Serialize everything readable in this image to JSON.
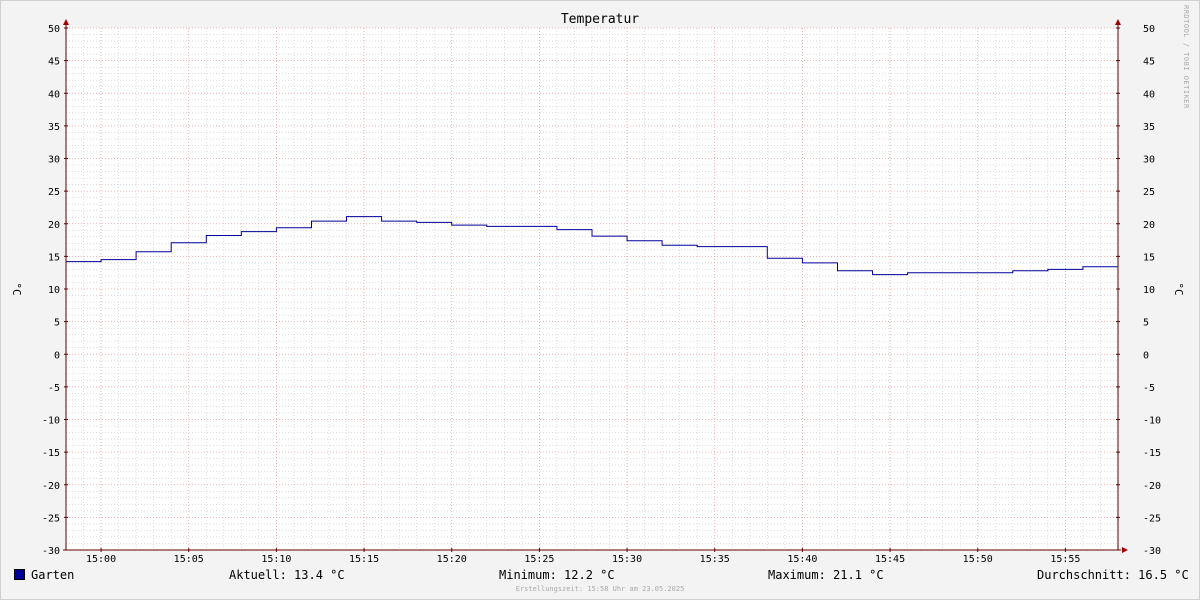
{
  "chart_data": {
    "type": "line",
    "title": "Temperatur",
    "ylabel": "°C",
    "ylabel_right": "°C",
    "ylim": [
      -30,
      50
    ],
    "y_ticks": [
      50,
      45,
      40,
      35,
      30,
      25,
      20,
      15,
      10,
      5,
      0,
      -5,
      -10,
      -15,
      -20,
      -25,
      -30
    ],
    "x_range": [
      "14:58",
      "15:58"
    ],
    "x_ticks": [
      "15:00",
      "15:05",
      "15:10",
      "15:15",
      "15:20",
      "15:25",
      "15:30",
      "15:35",
      "15:40",
      "15:45",
      "15:50",
      "15:55"
    ],
    "grid": true,
    "step": true,
    "legend_position": "bottom-left",
    "series": [
      {
        "name": "Garten",
        "color": "#000099",
        "x": [
          "14:58",
          "15:00",
          "15:02",
          "15:04",
          "15:06",
          "15:08",
          "15:10",
          "15:12",
          "15:14",
          "15:16",
          "15:18",
          "15:20",
          "15:22",
          "15:24",
          "15:26",
          "15:28",
          "15:30",
          "15:32",
          "15:34",
          "15:36",
          "15:38",
          "15:40",
          "15:42",
          "15:44",
          "15:46",
          "15:48",
          "15:50",
          "15:52",
          "15:54",
          "15:56",
          "15:58"
        ],
        "values": [
          14.2,
          14.5,
          15.7,
          17.1,
          18.2,
          18.8,
          19.4,
          20.4,
          21.1,
          20.4,
          20.2,
          19.8,
          19.6,
          19.6,
          19.1,
          18.1,
          17.4,
          16.7,
          16.5,
          16.5,
          14.7,
          14.0,
          12.8,
          12.2,
          12.5,
          12.5,
          12.5,
          12.8,
          13.0,
          13.4,
          13.4
        ]
      }
    ],
    "colors": {
      "grid_major": "#e7a0a0",
      "grid_minor": "#c8c8c8",
      "axis": "#600000",
      "background": "#ffffff",
      "page": "#f3f3f3"
    }
  },
  "legend": {
    "series_label": "Garten",
    "current": "Aktuell: 13.4 °C",
    "minimum": "Minimum: 12.2 °C",
    "maximum": "Maximum: 21.1 °C",
    "average": "Durchschnitt: 16.5 °C"
  },
  "footer": "Erstellungszeit: 15:58 Uhr am 23.05.2025",
  "watermark": "RRDTOOL / TOBI OETIKER"
}
